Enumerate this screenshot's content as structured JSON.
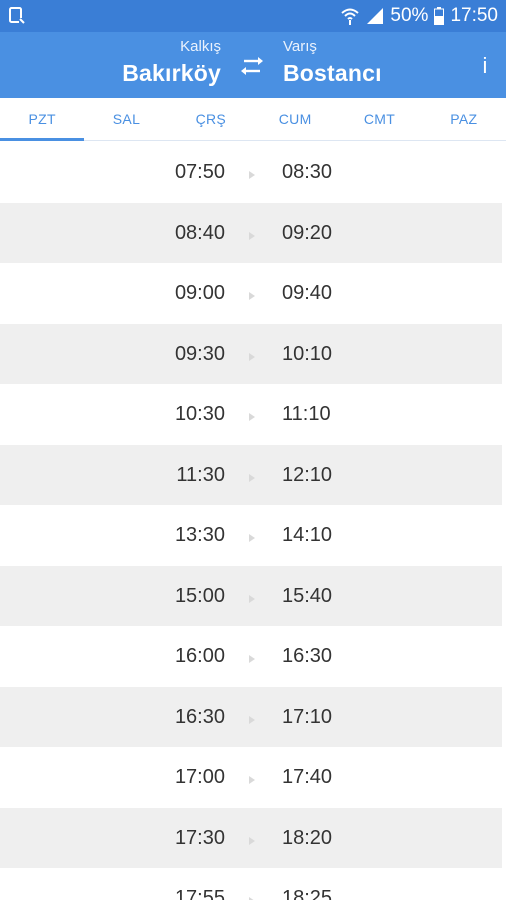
{
  "status_bar": {
    "battery_percent": "50%",
    "time": "17:50"
  },
  "header": {
    "from_label": "Kalkış",
    "from_station": "Bakırköy",
    "to_label": "Varış",
    "to_station": "Bostancı",
    "info_label": "i"
  },
  "tabs": [
    {
      "label": "PZT",
      "active": true
    },
    {
      "label": "SAL",
      "active": false
    },
    {
      "label": "ÇRŞ",
      "active": false
    },
    {
      "label": "CUM",
      "active": false
    },
    {
      "label": "CMT",
      "active": false
    },
    {
      "label": "PAZ",
      "active": false
    }
  ],
  "schedule": [
    {
      "departure": "07:50",
      "arrival": "08:30"
    },
    {
      "departure": "08:40",
      "arrival": "09:20"
    },
    {
      "departure": "09:00",
      "arrival": "09:40"
    },
    {
      "departure": "09:30",
      "arrival": "10:10"
    },
    {
      "departure": "10:30",
      "arrival": "11:10"
    },
    {
      "departure": "11:30",
      "arrival": "12:10"
    },
    {
      "departure": "13:30",
      "arrival": "14:10"
    },
    {
      "departure": "15:00",
      "arrival": "15:40"
    },
    {
      "departure": "16:00",
      "arrival": "16:30"
    },
    {
      "departure": "16:30",
      "arrival": "17:10"
    },
    {
      "departure": "17:00",
      "arrival": "17:40"
    },
    {
      "departure": "17:30",
      "arrival": "18:20"
    },
    {
      "departure": "17:55",
      "arrival": "18:25"
    }
  ],
  "colors": {
    "primary": "#4a90e2",
    "status_bar": "#3a7ed6",
    "row_alt": "#efefef",
    "text": "#333333"
  }
}
